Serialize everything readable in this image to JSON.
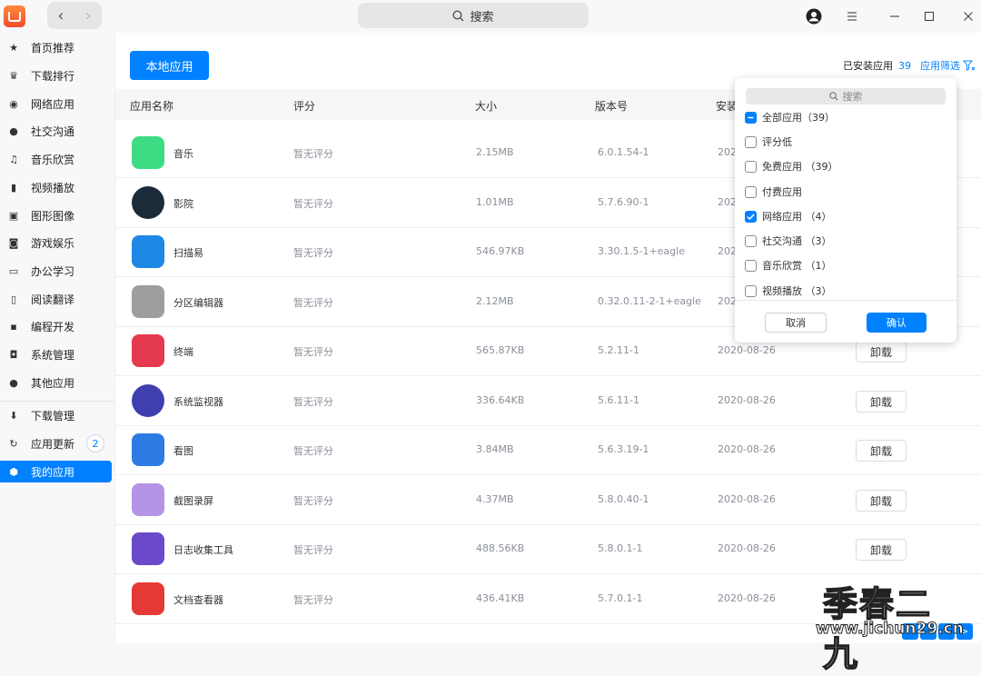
{
  "titlebar": {
    "search_label": "搜索",
    "back": "‹",
    "forward": "›"
  },
  "sidebar": {
    "items": [
      {
        "label": "首页推荐",
        "icon": "star-icon"
      },
      {
        "label": "下载排行",
        "icon": "crown-icon"
      },
      {
        "label": "网络应用",
        "icon": "globe-icon"
      },
      {
        "label": "社交沟通",
        "icon": "chat-icon"
      },
      {
        "label": "音乐欣赏",
        "icon": "music-icon"
      },
      {
        "label": "视频播放",
        "icon": "film-icon"
      },
      {
        "label": "图形图像",
        "icon": "image-icon"
      },
      {
        "label": "游戏娱乐",
        "icon": "gamepad-icon"
      },
      {
        "label": "办公学习",
        "icon": "office-icon"
      },
      {
        "label": "阅读翻译",
        "icon": "book-icon"
      },
      {
        "label": "编程开发",
        "icon": "terminal-icon"
      },
      {
        "label": "系统管理",
        "icon": "system-icon"
      },
      {
        "label": "其他应用",
        "icon": "more-icon"
      }
    ],
    "bottom": [
      {
        "label": "下载管理",
        "icon": "download-icon"
      },
      {
        "label": "应用更新",
        "icon": "update-icon",
        "badge": "2"
      },
      {
        "label": "我的应用",
        "icon": "box-icon",
        "active": true
      }
    ]
  },
  "main": {
    "local_apps_button": "本地应用",
    "installed_label": "已安装应用",
    "installed_count": "39",
    "filter_label": "应用筛选",
    "columns": [
      "应用名称",
      "评分",
      "大小",
      "版本号",
      "安装"
    ],
    "rows": [
      {
        "name": "音乐",
        "rating": "暂无评分",
        "size": "2.15MB",
        "version": "6.0.1.54-1",
        "date": "2020",
        "uninstall": "",
        "color": "#3ddc84"
      },
      {
        "name": "影院",
        "rating": "暂无评分",
        "size": "1.01MB",
        "version": "5.7.6.90-1",
        "date": "2020",
        "uninstall": "",
        "color": "#1c2b3a"
      },
      {
        "name": "扫描易",
        "rating": "暂无评分",
        "size": "546.97KB",
        "version": "3.30.1.5-1+eagle",
        "date": "2020",
        "uninstall": "",
        "color": "#1e88e5"
      },
      {
        "name": "分区编辑器",
        "rating": "暂无评分",
        "size": "2.12MB",
        "version": "0.32.0.11-2-1+eagle",
        "date": "2020",
        "uninstall": "",
        "color": "#9e9e9e"
      },
      {
        "name": "终端",
        "rating": "暂无评分",
        "size": "565.87KB",
        "version": "5.2.11-1",
        "date": "2020-08-26",
        "uninstall": "卸载",
        "color": "#e53950"
      },
      {
        "name": "系统监视器",
        "rating": "暂无评分",
        "size": "336.64KB",
        "version": "5.6.11-1",
        "date": "2020-08-26",
        "uninstall": "卸载",
        "color": "#3f3fb0"
      },
      {
        "name": "看图",
        "rating": "暂无评分",
        "size": "3.84MB",
        "version": "5.6.3.19-1",
        "date": "2020-08-26",
        "uninstall": "卸载",
        "color": "#2d7be5"
      },
      {
        "name": "截图录屏",
        "rating": "暂无评分",
        "size": "4.37MB",
        "version": "5.8.0.40-1",
        "date": "2020-08-26",
        "uninstall": "卸载",
        "color": "#b593e6"
      },
      {
        "name": "日志收集工具",
        "rating": "暂无评分",
        "size": "488.56KB",
        "version": "5.8.0.1-1",
        "date": "2020-08-26",
        "uninstall": "卸载",
        "color": "#6b49c8"
      },
      {
        "name": "文档查看器",
        "rating": "暂无评分",
        "size": "436.41KB",
        "version": "5.7.0.1-1",
        "date": "2020-08-26",
        "uninstall": "",
        "color": "#e53935"
      }
    ]
  },
  "filter_popup": {
    "search_placeholder": "搜索",
    "options": [
      {
        "label": "全部应用（39）",
        "state": "partial"
      },
      {
        "label": "评分低",
        "state": "unchecked"
      },
      {
        "label": "免费应用 （39）",
        "state": "unchecked"
      },
      {
        "label": "付费应用",
        "state": "unchecked"
      },
      {
        "label": "网络应用 （4）",
        "state": "checked"
      },
      {
        "label": "社交沟通 （3）",
        "state": "unchecked"
      },
      {
        "label": "音乐欣赏 （1）",
        "state": "unchecked"
      },
      {
        "label": "视频播放 （3）",
        "state": "unchecked"
      }
    ],
    "cancel_label": "取消",
    "confirm_label": "确认"
  },
  "watermark": {
    "text": "季春二九",
    "url": "www.jichun29.cn"
  },
  "pager": {
    "next": ">"
  },
  "colors": {
    "accent": "#0081ff"
  }
}
